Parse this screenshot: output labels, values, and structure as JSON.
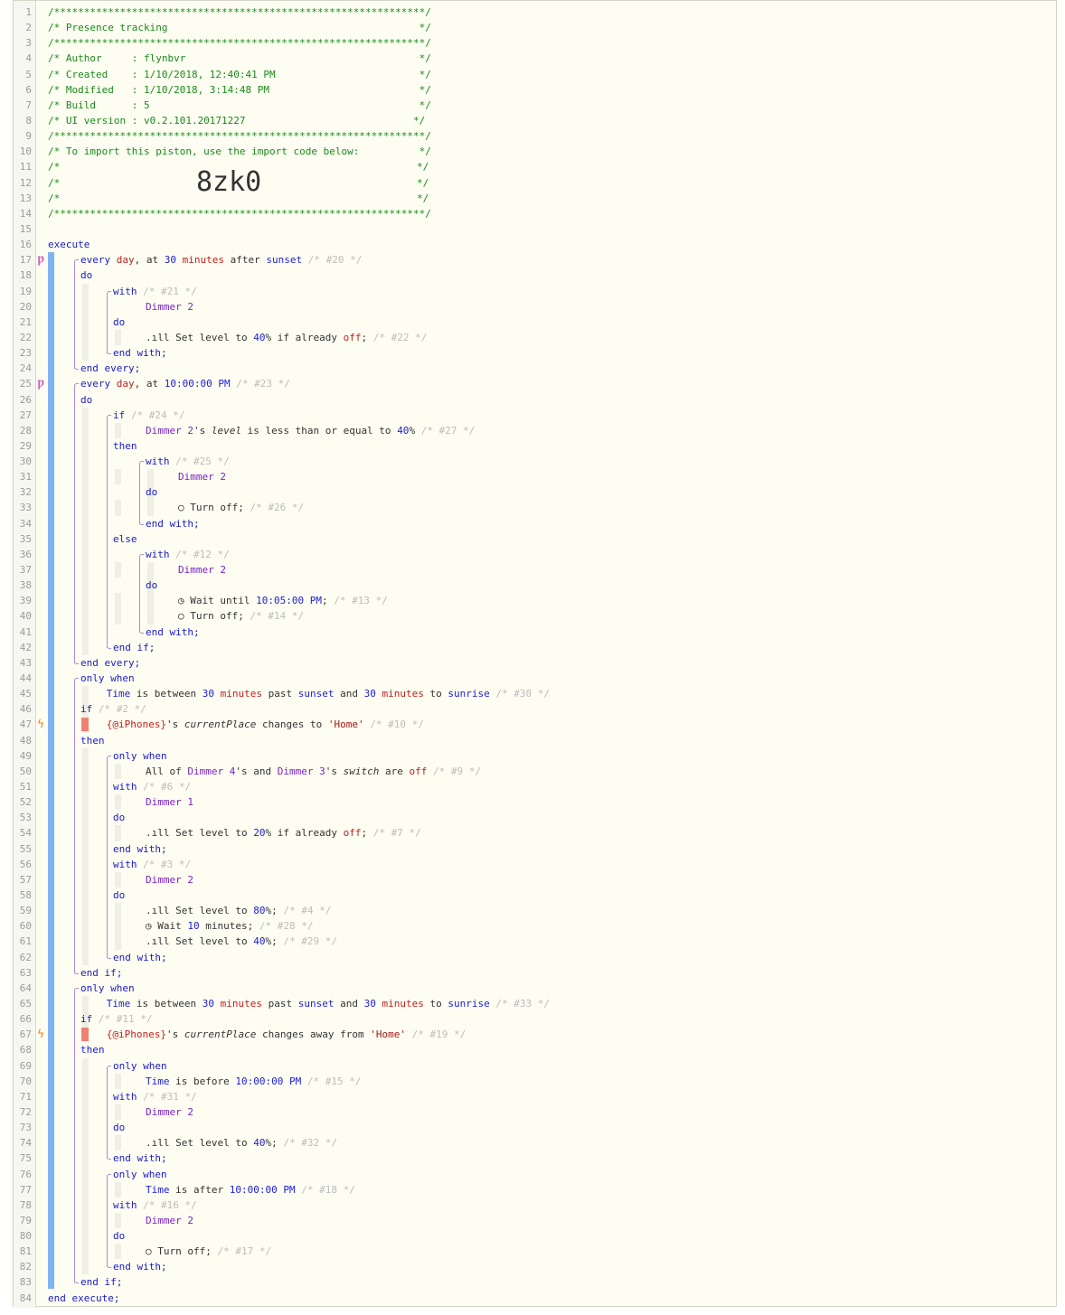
{
  "header": {
    "stars": "/**************************************************************/",
    "title": "/* Presence tracking                                          */",
    "author": "/* Author     : flynbvr                                       */",
    "created": "/* Created    : 1/10/2018, 12:40:41 PM                        */",
    "modified": "/* Modified   : 1/10/2018, 3:14:48 PM                         */",
    "build": "/* Build      : 5                                             */",
    "ui_version": "/* UI version : v0.2.101.20171227                            */",
    "import_note": "/* To import this piston, use the import code below:          */",
    "blank_comment_start": "/*",
    "blank_comment_end": "*/",
    "import_code": "8zk0"
  },
  "code": {
    "execute": "execute",
    "end_execute": "end execute;",
    "every1": {
      "kw": "every",
      "day": "day",
      "at": ", at",
      "num": "30",
      "unit": "minutes",
      "after": "after",
      "event": "sunset",
      "cmt": "/* #20 */"
    },
    "do": "do",
    "with": "with",
    "end_with": "end with;",
    "end_every": "end every;",
    "end_if": "end if;",
    "if": "if",
    "then": "then",
    "else": "else",
    "only_when": "only when",
    "dimmer1": "Dimmer 1",
    "dimmer2": "Dimmer 2",
    "dimmer3": "Dimmer 3",
    "dimmer4": "Dimmer 4",
    "c21": "/* #21 */",
    "set_level": "Set level to",
    "if_already": "if already",
    "off": "off",
    "pct40": "40",
    "pct20": "20",
    "pct80": "80",
    "c22": "/* #22 */",
    "every2": {
      "kw": "every",
      "day": "day",
      "at": ", at",
      "time": "10:00:00 PM",
      "cmt": "/* #23 */"
    },
    "c24": "/* #24 */",
    "level_attr": "level",
    "is_le": "is less than or equal to",
    "c27": "/* #27 */",
    "c25": "/* #25 */",
    "turn_off": "Turn off;",
    "c26": "/* #26 */",
    "c12": "/* #12 */",
    "wait_until": "Wait until",
    "t1005": "10:05:00 PM",
    "c13": "/* #13 */",
    "c14": "/* #14 */",
    "time": "Time",
    "is_between": "is between",
    "n30": "30",
    "minutes": "minutes",
    "past": "past",
    "sunset": "sunset",
    "and": "and",
    "to": "to",
    "sunrise": "sunrise",
    "c30": "/* #30 */",
    "c2": "/* #2 */",
    "iphones": "{@iPhones}",
    "s_apos": "'s",
    "current_place": "currentPlace",
    "changes_to": "changes to",
    "home": "'Home'",
    "c10": "/* #10 */",
    "all_of": "All of",
    "switch": "switch",
    "are": "are",
    "c9": "/* #9 */",
    "c6": "/* #6 */",
    "c7": "/* #7 */",
    "c3": "/* #3 */",
    "c4": "/* #4 */",
    "wait": "Wait",
    "n10": "10",
    "c28": "/* #28 */",
    "c29": "/* #29 */",
    "c33": "/* #33 */",
    "c11": "/* #11 */",
    "changes_away": "changes away from",
    "c19": "/* #19 */",
    "is_before": "is before",
    "t1000": "10:00:00 PM",
    "c15": "/* #15 */",
    "c31": "/* #31 */",
    "c32": "/* #32 */",
    "is_after": "is after",
    "c18": "/* #18 */",
    "c16": "/* #16 */",
    "c17": "/* #17 */"
  },
  "line_count": 84,
  "colors": {
    "keyword": "#1a1ac8",
    "device": "#7b22c8",
    "event": "#c02020",
    "comment": "#bcbcbc",
    "header": "#1b8a1b",
    "bar": "#7fb4f0"
  }
}
